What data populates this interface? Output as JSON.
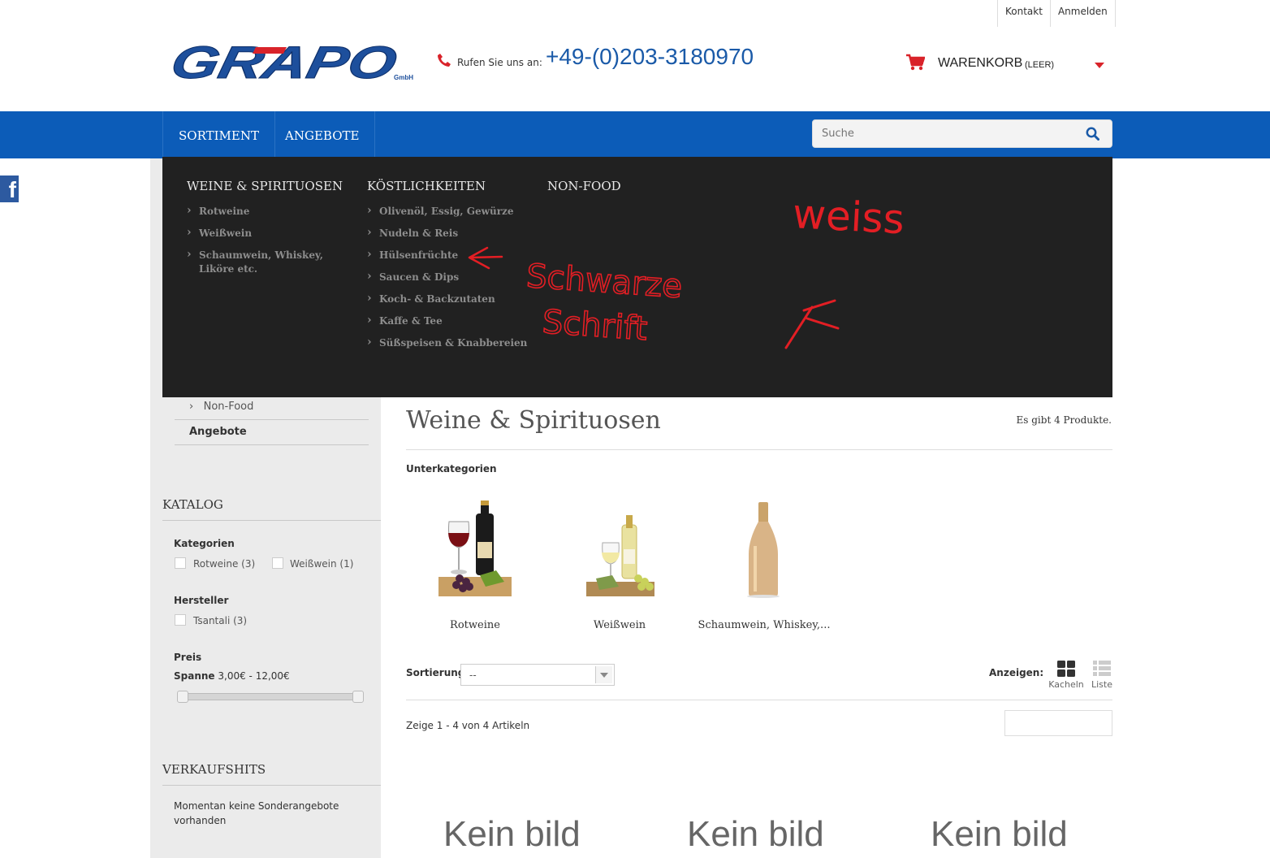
{
  "top_links": {
    "contact": "Kontakt",
    "login": "Anmelden"
  },
  "header": {
    "logo_text": "GRAPO",
    "logo_sub": "GmbH",
    "phone_label": "Rufen Sie uns an:",
    "phone_number": "+49-(0)203-3180970",
    "cart_label": "WARENKORB",
    "cart_status": "(LEER)"
  },
  "nav": {
    "items": [
      "SORTIMENT",
      "ANGEBOTE"
    ],
    "search_placeholder": "Suche"
  },
  "mega_menu": {
    "columns": [
      {
        "heading": "WEINE & SPIRITUOSEN",
        "items": [
          "Rotweine",
          "Weißwein",
          "Schaumwein, Whiskey, Liköre etc."
        ]
      },
      {
        "heading": "KÖSTLICHKEITEN",
        "items": [
          "Olivenöl, Essig, Gewürze",
          "Nudeln & Reis",
          "Hülsenfrüchte",
          "Saucen & Dips",
          "Koch- & Backzutaten",
          "Kaffe & Tee",
          "Süßspeisen & Knabbereien"
        ]
      },
      {
        "heading": "NON-FOOD",
        "items": []
      }
    ]
  },
  "annotations": {
    "text_white": "weiss",
    "text_black_1": "Schwarze",
    "text_black_2": "Schrift",
    "color": "#e31e24"
  },
  "sidebar": {
    "tree_nonfood": "Non-Food",
    "tree_angebote": "Angebote",
    "katalog_title": "KATALOG",
    "kategorien_title": "Kategorien",
    "kategorien": [
      "Rotweine (3)",
      "Weißwein (1)"
    ],
    "hersteller_title": "Hersteller",
    "hersteller": [
      "Tsantali (3)"
    ],
    "preis_title": "Preis",
    "spanne_label": "Spanne",
    "spanne_value": "3,00€ - 12,00€",
    "price_min": 3,
    "price_max": 12,
    "verkaufshits_title": "VERKAUFSHITS",
    "verkaufshits_text": "Momentan keine Sonderangebote vorhanden"
  },
  "main": {
    "title": "Weine & Spirituosen",
    "product_count": "Es gibt 4 Produkte.",
    "subcategories_label": "Unterkategorien",
    "subcategories": [
      "Rotweine",
      "Weißwein",
      "Schaumwein, Whiskey,..."
    ],
    "sort_label": "Sortierung",
    "sort_value": "--",
    "view_label": "Anzeigen:",
    "view_grid": "Kacheln",
    "view_list": "Liste",
    "showing": "Zeige 1 - 4 von 4 Artikeln",
    "no_image": "Kein bild"
  },
  "colors": {
    "brand_blue": "#0c5cb8",
    "accent_red": "#d9232a",
    "menu_bg": "#212121"
  }
}
